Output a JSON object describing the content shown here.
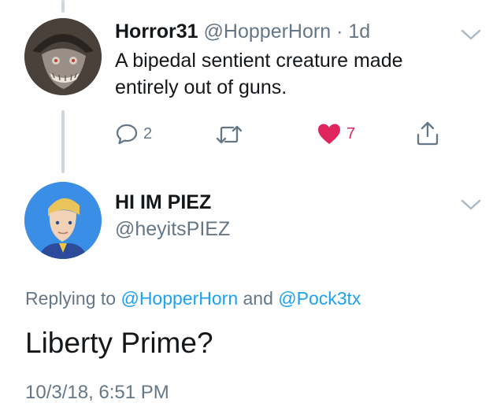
{
  "tweet": {
    "display_name": "Horror31",
    "handle": "@HopperHorn",
    "separator": "·",
    "time": "1d",
    "text_line1": "A bipedal sentient creature made",
    "text_line2": "entirely out of guns.",
    "reply_count": "2",
    "like_count": "7",
    "icons": [
      "reply-icon",
      "retweet-icon",
      "heart-icon",
      "share-icon",
      "chevron-down-icon"
    ],
    "like_color": "#e0245e"
  },
  "reply": {
    "display_name": "HI IM PIEZ",
    "handle": "@heyitsPIEZ",
    "replying_prefix": "Replying to",
    "mention1": "@HopperHorn",
    "conjunction": "and",
    "mention2": "@Pock3tx",
    "text": "Liberty Prime?",
    "timestamp": "10/3/18, 6:51 PM"
  },
  "colors": {
    "link": "#1da1f2",
    "secondary_text": "#657786",
    "thread_line": "#ccd6dd"
  }
}
